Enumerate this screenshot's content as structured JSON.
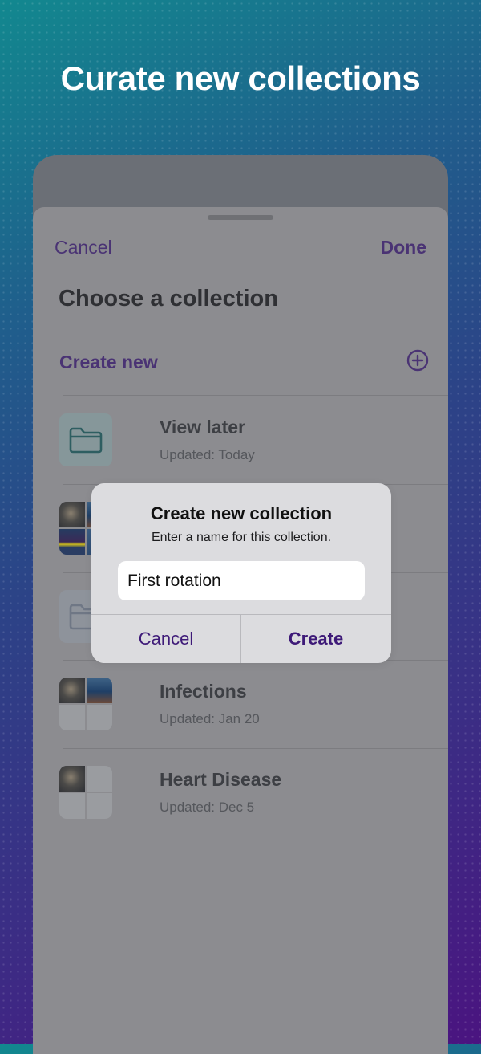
{
  "headline": "Curate new collections",
  "sheet": {
    "cancel_label": "Cancel",
    "done_label": "Done",
    "title": "Choose a collection",
    "create_new_label": "Create new",
    "items": [
      {
        "title": "View later",
        "subtitle": "Updated: Today"
      },
      {
        "title": "Infections",
        "subtitle": "Updated: Jan 20"
      },
      {
        "title": "Heart Disease",
        "subtitle": "Updated: Dec 5"
      }
    ]
  },
  "dialog": {
    "title": "Create new collection",
    "message": "Enter a name for this collection.",
    "input_value": "First rotation",
    "cancel_label": "Cancel",
    "create_label": "Create"
  },
  "colors": {
    "accent": "#4a3374",
    "dialog_button": "#3e1a78"
  }
}
